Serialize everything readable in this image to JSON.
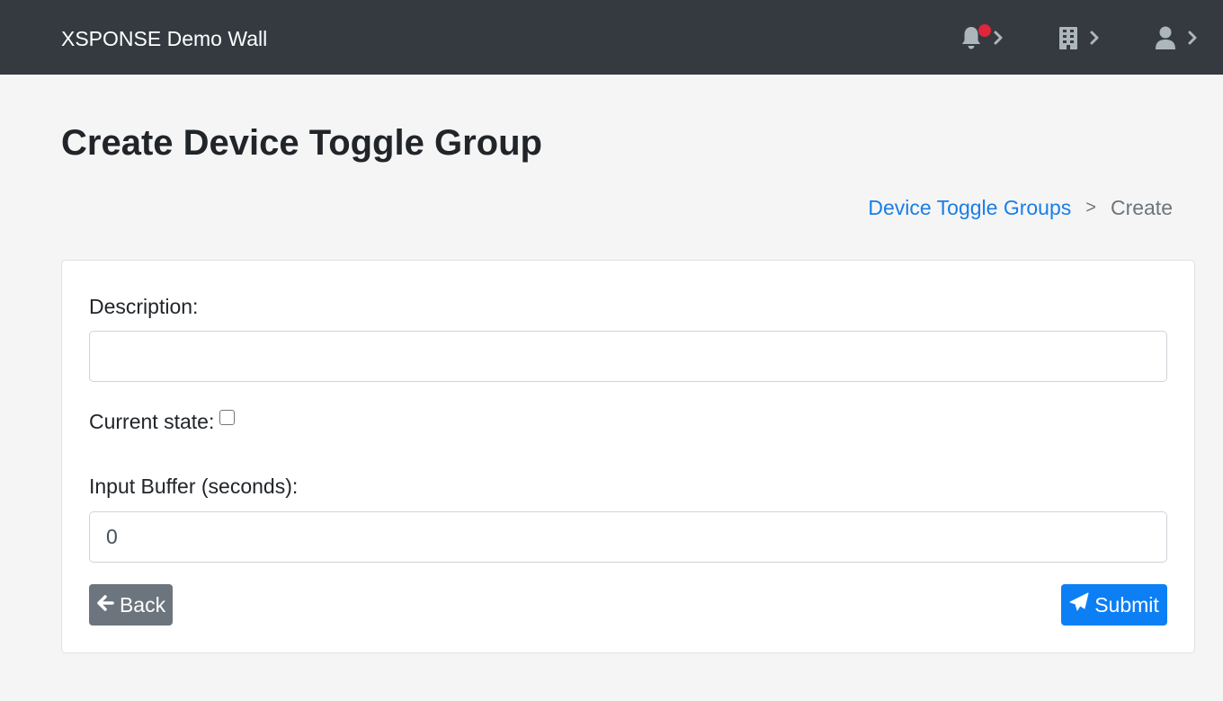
{
  "navbar": {
    "brand": "XSPONSE Demo Wall",
    "icons": [
      "bell-icon",
      "building-icon",
      "user-icon"
    ],
    "notification_dot_color": "#e0263a",
    "background": "#343a40"
  },
  "page": {
    "title": "Create Device Toggle Group"
  },
  "breadcrumb": {
    "parent": "Device Toggle Groups",
    "separator": ">",
    "current": "Create"
  },
  "form": {
    "description_label": "Description:",
    "description_value": "",
    "current_state_label": "Current state:",
    "current_state_checked": false,
    "input_buffer_label": "Input Buffer (seconds):",
    "input_buffer_value": "0"
  },
  "buttons": {
    "back_label": "Back",
    "submit_label": "Submit"
  },
  "colors": {
    "link": "#1a7ee6",
    "primary": "#0d7ff5",
    "secondary": "#6c757d"
  }
}
